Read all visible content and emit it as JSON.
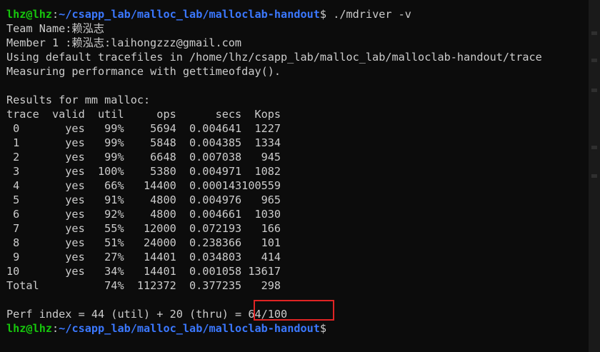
{
  "prompt": {
    "user_host": "lhz@lhz",
    "colon": ":",
    "path": "~/csapp_lab/malloc_lab/malloclab-handout",
    "dollar": "$",
    "command": " ./mdriver -v"
  },
  "header_lines": [
    "Team Name:赖泓志",
    "Member 1 :赖泓志:laihongzzz@gmail.com",
    "Using default tracefiles in /home/lhz/csapp_lab/malloc_lab/malloclab-handout/trace",
    "Measuring performance with gettimeofday()."
  ],
  "results_title": "Results for mm malloc:",
  "table": {
    "header": "trace  valid  util     ops      secs  Kops",
    "rows": [
      " 0       yes   99%    5694  0.004641  1227",
      " 1       yes   99%    5848  0.004385  1334",
      " 2       yes   99%    6648  0.007038   945",
      " 3       yes  100%    5380  0.004971  1082",
      " 4       yes   66%   14400  0.000143100559",
      " 5       yes   91%    4800  0.004976   965",
      " 6       yes   92%    4800  0.004661  1030",
      " 7       yes   55%   12000  0.072193   166",
      " 8       yes   51%   24000  0.238366   101",
      " 9       yes   27%   14401  0.034803   414",
      "10       yes   34%   14401  0.001058 13617"
    ],
    "total": "Total          74%  112372  0.377235   298"
  },
  "perf_index": "Perf index = 44 (util) + 20 (thru) = 64/100",
  "colors": {
    "background": "#0c0c0c",
    "text": "#cccccc",
    "prompt_user": "#16c60c",
    "prompt_path": "#3b78ff",
    "highlight_box": "#e02424"
  }
}
